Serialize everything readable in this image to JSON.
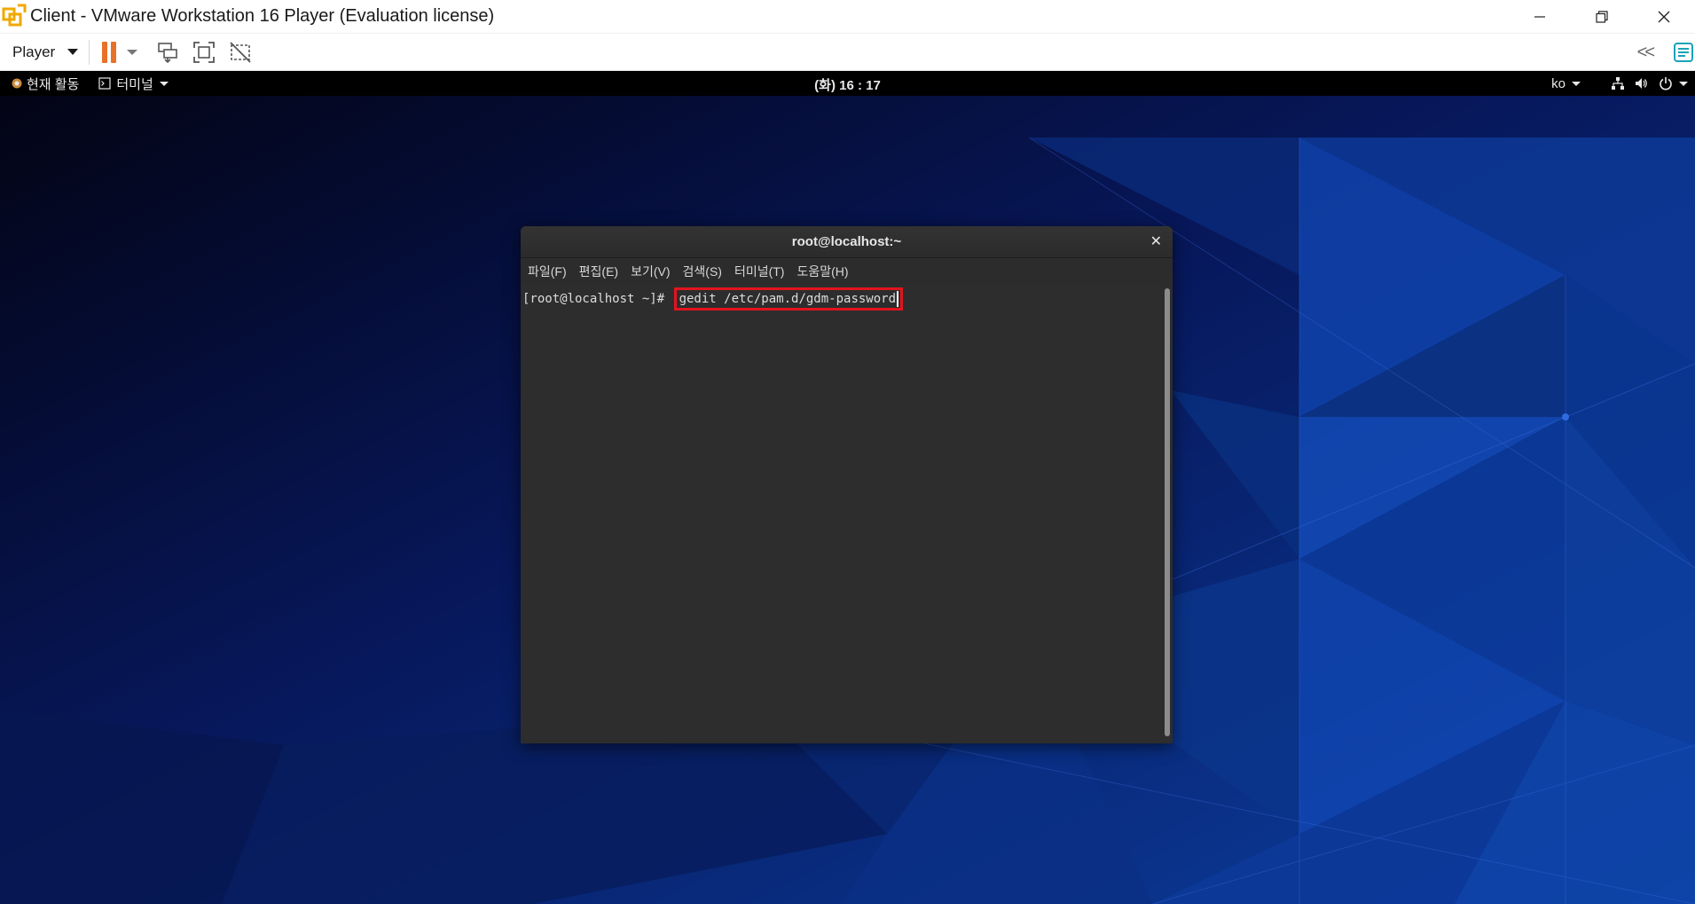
{
  "window": {
    "title": "Client - VMware Workstation 16 Player (Evaluation license)",
    "controls": [
      "minimize",
      "restore",
      "close"
    ]
  },
  "toolbar": {
    "player_label": "Player",
    "icons": [
      "pause-icon",
      "send-ctrl-alt-del-icon",
      "full-screen-icon",
      "unity-icon"
    ],
    "right_icons": [
      "collapse-icon",
      "message-log-icon"
    ],
    "collapse_glyph": "<<"
  },
  "guest_topbar": {
    "activities_label": "현재 활동",
    "app_menu_label": "터미널",
    "clock": "(화) 16 : 17",
    "input_method": "ko"
  },
  "terminal": {
    "title": "root@localhost:~",
    "menu": [
      "파일(F)",
      "편집(E)",
      "보기(V)",
      "검색(S)",
      "터미널(T)",
      "도움말(H)"
    ],
    "prompt": "[root@localhost ~]# ",
    "command": "gedit /etc/pam.d/gdm-password"
  },
  "colors": {
    "highlight_box": "#e3141e",
    "pause_accent": "#e8712a",
    "terminal_bg": "#2d2d2d"
  }
}
